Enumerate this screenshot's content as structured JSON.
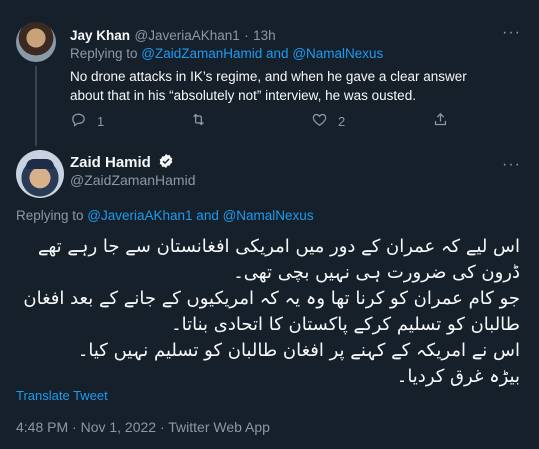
{
  "reply": {
    "name": "Jay Khan",
    "handle": "@JaveriaAKhan1",
    "separator": "·",
    "time": "13h",
    "replying_prefix": "Replying to ",
    "replying_to": "@ZaidZamanHamid and @NamalNexus",
    "text": "No drone attacks in IK’s regime, and when he gave a clear answer about that in his “absolutely not” interview, he was ousted.",
    "reply_count": "1",
    "like_count": "2",
    "more": "···"
  },
  "main": {
    "name": "Zaid Hamid",
    "handle": "@ZaidZamanHamid",
    "more": "···",
    "replying_prefix": "Replying to ",
    "replying_to": "@JaveriaAKhan1 and @NamalNexus",
    "text": "اس لیے کہ عمران کے دور میں امریکی افغانستان سے جا رہے تھے ڈرون کی ضرورت ہی نہیں بچی تھی۔\nجو کام عمران کو کرنا تھا وہ یہ کہ امریکیوں کے جانے کے بعد افغان طالبان کو تسلیم کرکے پاکستان کا اتحادی بناتا۔\nاس نے امریکہ کے کہنے پر افغان طالبان کو تسلیم نہیں کیا۔\nبیڑہ غرق کردیا۔",
    "translate": "Translate Tweet",
    "timestamp": "4:48 PM · Nov 1, 2022 · Twitter Web App"
  },
  "icons": {
    "reply": "reply-icon",
    "retweet": "retweet-icon",
    "like": "like-icon",
    "share": "share-icon",
    "verified": "verified-badge-icon"
  },
  "colors": {
    "background": "#15202b",
    "text": "#f7f9f9",
    "muted": "#8b98a5",
    "link": "#1d9bf0",
    "line": "#38444d"
  }
}
